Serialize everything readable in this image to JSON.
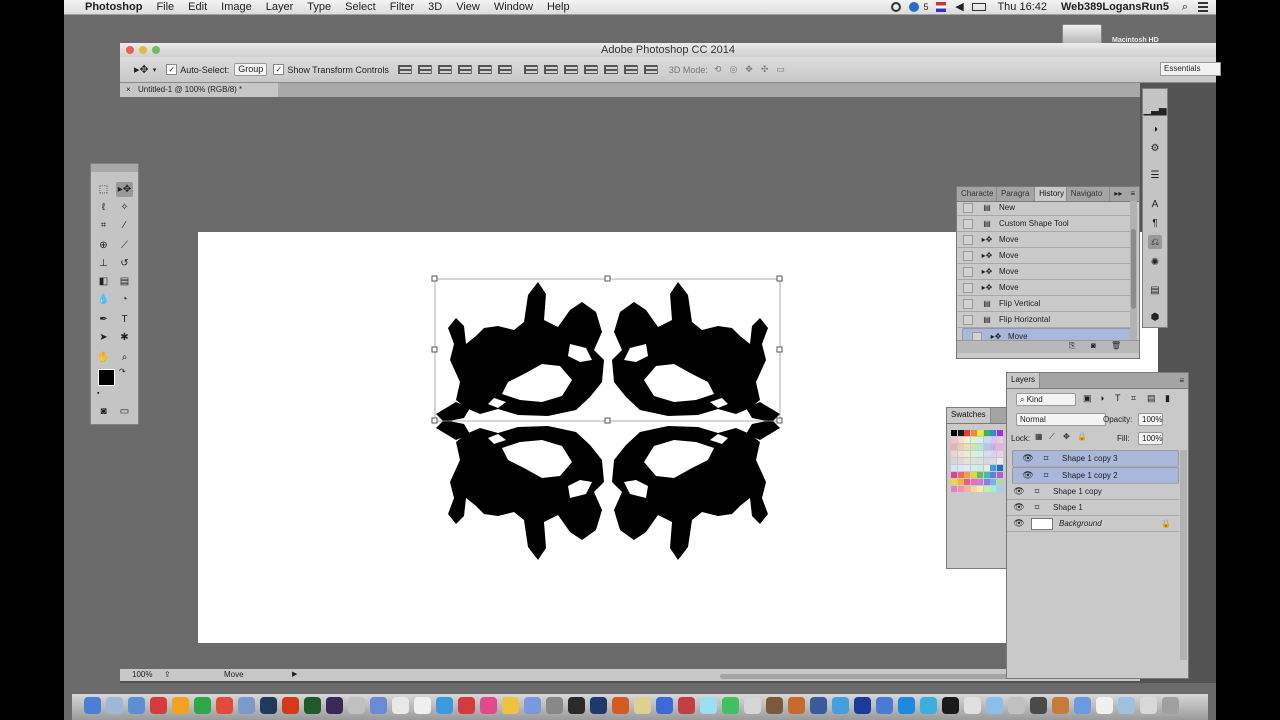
{
  "menubar": {
    "app_name": "Photoshop",
    "menus": [
      "File",
      "Edit",
      "Image",
      "Layer",
      "Type",
      "Select",
      "Filter",
      "3D",
      "View",
      "Window",
      "Help"
    ],
    "status_count": "5",
    "clock": "Thu 16:42",
    "user": "Web389LogansRun5"
  },
  "desktop": {
    "hd_label": "Macintosh HD"
  },
  "window": {
    "title": "Adobe Photoshop CC 2014"
  },
  "options_bar": {
    "auto_select_label": "Auto-Select:",
    "auto_select_value": "Group",
    "show_transform_label": "Show Transform Controls",
    "mode3d_label": "3D Mode:",
    "workspace": "Essentials"
  },
  "document": {
    "tab_title": "Untitled-1 @ 100% (RGB/8) *",
    "zoom": "100%",
    "status_info": "Move"
  },
  "history_panel": {
    "tabs": [
      "Characte",
      "Paragra",
      "History",
      "Navigato"
    ],
    "active_tab": "History",
    "items": [
      {
        "label": "New",
        "icon": "document-icon"
      },
      {
        "label": "Custom Shape Tool",
        "icon": "document-icon"
      },
      {
        "label": "Move",
        "icon": "move-icon"
      },
      {
        "label": "Move",
        "icon": "move-icon"
      },
      {
        "label": "Move",
        "icon": "move-icon"
      },
      {
        "label": "Move",
        "icon": "move-icon"
      },
      {
        "label": "Flip Vertical",
        "icon": "document-icon"
      },
      {
        "label": "Flip Horizontal",
        "icon": "document-icon"
      },
      {
        "label": "Move",
        "icon": "move-icon"
      }
    ],
    "selected_index": 8
  },
  "swatches_panel": {
    "title": "Swatches",
    "colors": [
      "#000000",
      "#1c1c1c",
      "#e53b3b",
      "#f08a2c",
      "#f5e63a",
      "#3bb54a",
      "#2c8be5",
      "#a42ce5",
      "#f7c3c3",
      "#f7dcc3",
      "#f7f0c3",
      "#dbf7c3",
      "#c3f7e9",
      "#c3dcf7",
      "#dcc3f7",
      "#f7c3ef",
      "#e8b0b0",
      "#e8cdb0",
      "#e8e0b0",
      "#c9e8b0",
      "#b0e8d9",
      "#b0c9e8",
      "#c9b0e8",
      "#e8b0de",
      "#f0d0d0",
      "#f0e0d0",
      "#f0ecd0",
      "#dff0d0",
      "#d0f0e8",
      "#d0dff0",
      "#dfd0f0",
      "#f0d0ea",
      "#d6d6d6",
      "#e3d6d6",
      "#e3e3d6",
      "#d6e3d6",
      "#d6e3e3",
      "#d6d6e3",
      "#e3d6e3",
      "#ececec",
      "#cfe8f0",
      "#d8e8f8",
      "#e0eaf8",
      "#d0f0f0",
      "#c8f0e0",
      "#e0f0d8",
      "#3a9dde",
      "#1f6fbf",
      "#e8409a",
      "#f06a6a",
      "#f0a040",
      "#e8d040",
      "#60c060",
      "#40c0b0",
      "#6080e0",
      "#b060d0",
      "#f7d23a",
      "#f2b632",
      "#e95d8c",
      "#ef6fb0",
      "#c77de0",
      "#8d7be8",
      "#6bb7f0",
      "#a6e0a0",
      "#e97fc9",
      "#f48fb8",
      "#f7b0a0",
      "#f7d6a0",
      "#f0f0a0",
      "#c0f0a0",
      "#a0f0d0",
      "#a0d0f0"
    ]
  },
  "layers_panel": {
    "title": "Layers",
    "filter_kind": "Kind",
    "blend_mode": "Normal",
    "opacity_label": "Opacity:",
    "opacity": "100%",
    "lock_label": "Lock:",
    "fill_label": "Fill:",
    "fill": "100%",
    "layers": [
      {
        "name": "Shape 1 copy 3",
        "selected": true
      },
      {
        "name": "Shape 1 copy 2",
        "selected": true
      },
      {
        "name": "Shape 1 copy",
        "selected": false
      },
      {
        "name": "Shape 1",
        "selected": false
      },
      {
        "name": "Background",
        "selected": false
      }
    ]
  },
  "colors": {
    "foreground": "#000000",
    "background": "#f4a3f0"
  },
  "dock": {
    "app_colors": [
      "#4a7fd6",
      "#9fb6d6",
      "#5b8fd6",
      "#d63b3b",
      "#f4a020",
      "#2aa84a",
      "#e24a3a",
      "#7a9acc",
      "#1f3a5a",
      "#d43a1a",
      "#1f5a2a",
      "#3a2a5a",
      "#c0c0c0",
      "#6a8ad6",
      "#e8e8e8",
      "#f0f0f0",
      "#3a9ae0",
      "#d63b3b",
      "#e04a8a",
      "#f0c040",
      "#7a9ae0",
      "#888888",
      "#2a2a2a",
      "#1f3a6a",
      "#d45a20",
      "#e0d090",
      "#3a6ad6",
      "#c04040",
      "#9ae0f0",
      "#40c060",
      "#d6d6d6",
      "#7a5a3a",
      "#c86a2a",
      "#3a5aa0",
      "#40a0e0",
      "#1a3aa0",
      "#4a7ad6",
      "#1a8ae0",
      "#3ab0e0",
      "#1a1a1a",
      "#e0e0e0",
      "#8ac0e8",
      "#c0c0c0",
      "#4a4a4a",
      "#c87a3a",
      "#6a9ae0",
      "#f0f0f0",
      "#a0c0e0",
      "#d8d8d8",
      "#a0a0a0"
    ]
  }
}
